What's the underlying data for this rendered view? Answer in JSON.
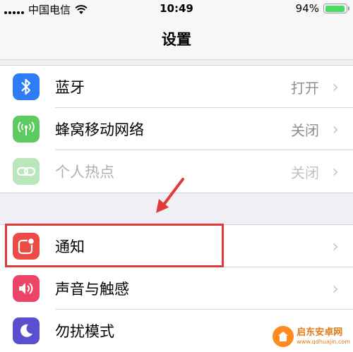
{
  "status": {
    "carrier": "中国电信",
    "time": "10:49",
    "battery_percent": "94%",
    "battery_level": 0.94
  },
  "nav": {
    "title": "设置"
  },
  "group1": [
    {
      "label": "蓝牙",
      "value": "打开",
      "icon": "bluetooth-icon",
      "color": "#2f7cf6"
    },
    {
      "label": "蜂窝移动网络",
      "value": "关闭",
      "icon": "cellular-icon",
      "color": "#5ecb60"
    },
    {
      "label": "个人热点",
      "value": "关闭",
      "icon": "hotspot-icon",
      "color": "#b9e6bb"
    }
  ],
  "group2": [
    {
      "label": "通知",
      "icon": "notifications-icon",
      "color": "#ec4c45"
    },
    {
      "label": "声音与触感",
      "icon": "sounds-icon",
      "color": "#ec4466"
    },
    {
      "label": "勿扰模式",
      "icon": "do-not-disturb-icon",
      "color": "#5a4fcf"
    }
  ],
  "annotation": {
    "highlight_color": "#e23a3a"
  },
  "watermark": {
    "text": "启东安卓网",
    "sub": "www.qdhuajin.com"
  }
}
